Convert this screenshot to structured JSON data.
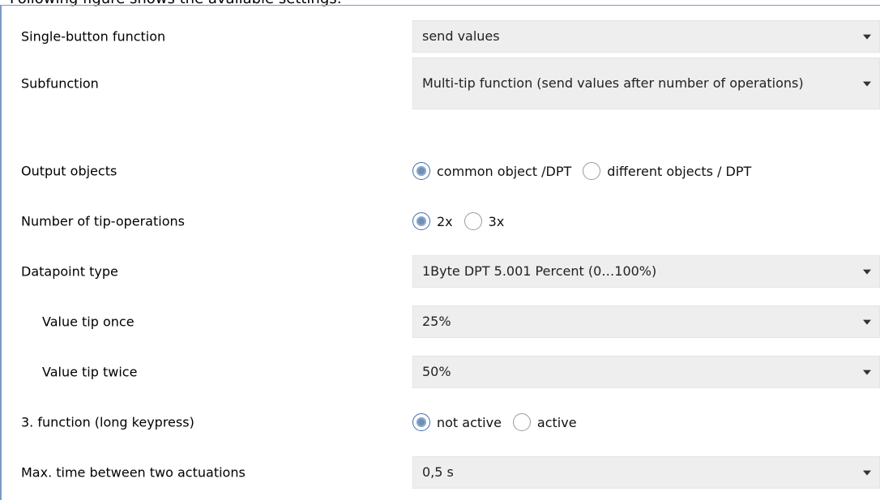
{
  "caption": "Following figure shows the available settings:",
  "rows": [
    {
      "label": "Single-button function",
      "type": "select",
      "value": "send values"
    },
    {
      "label": "Subfunction",
      "type": "select",
      "value": "Multi-tip function (send values after number of operations)"
    },
    {
      "label": "Output objects",
      "type": "radio",
      "options": [
        "common object /DPT",
        "different objects / DPT"
      ],
      "selected": 0
    },
    {
      "label": "Number of tip-operations",
      "type": "radio",
      "options": [
        "2x",
        "3x"
      ],
      "selected": 0
    },
    {
      "label": "Datapoint type",
      "type": "select",
      "value": "1Byte DPT 5.001 Percent (0…100%)"
    },
    {
      "label": "Value tip once",
      "type": "select",
      "value": "25%"
    },
    {
      "label": "Value tip twice",
      "type": "select",
      "value": "50%"
    },
    {
      "label": "3. function (long keypress)",
      "type": "radio",
      "options": [
        "not active",
        "active"
      ],
      "selected": 0
    },
    {
      "label": "Max. time between two actuations",
      "type": "select",
      "value": "0,5 s"
    }
  ],
  "colors": {
    "panel_border": "#7a9cc4",
    "select_bg": "#eeeeee",
    "radio_checked": "#6f8fb8"
  }
}
